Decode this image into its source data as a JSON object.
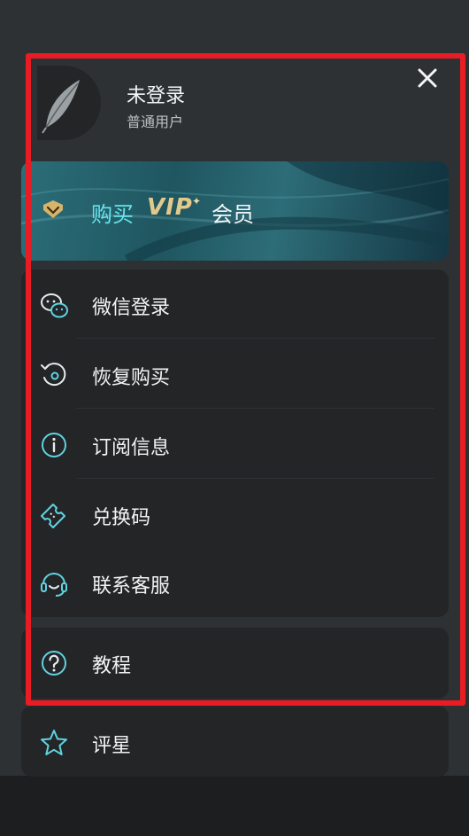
{
  "profile": {
    "title": "未登录",
    "subtitle": "普通用户",
    "avatar_icon": "feather-icon"
  },
  "header": {
    "close_icon": "close-icon"
  },
  "vip": {
    "buy_label": "购买",
    "vip_mark": "VIP",
    "spark": "✦",
    "member_label": "会员",
    "badge_icon": "vip-badge-icon"
  },
  "menu": {
    "items": [
      {
        "label": "微信登录",
        "icon": "wechat-icon"
      },
      {
        "label": "恢复购买",
        "icon": "restore-icon"
      },
      {
        "label": "订阅信息",
        "icon": "info-icon"
      },
      {
        "label": "兑换码",
        "icon": "ticket-icon"
      },
      {
        "label": "联系客服",
        "icon": "headset-icon"
      },
      {
        "label": "教程",
        "icon": "help-icon"
      },
      {
        "label": "评星",
        "icon": "star-icon"
      }
    ]
  },
  "colors": {
    "accent": "#5fd3e0",
    "highlight_border": "#ea1c23",
    "vip_gold": "#e3c98a",
    "card_bg": "#232527"
  }
}
